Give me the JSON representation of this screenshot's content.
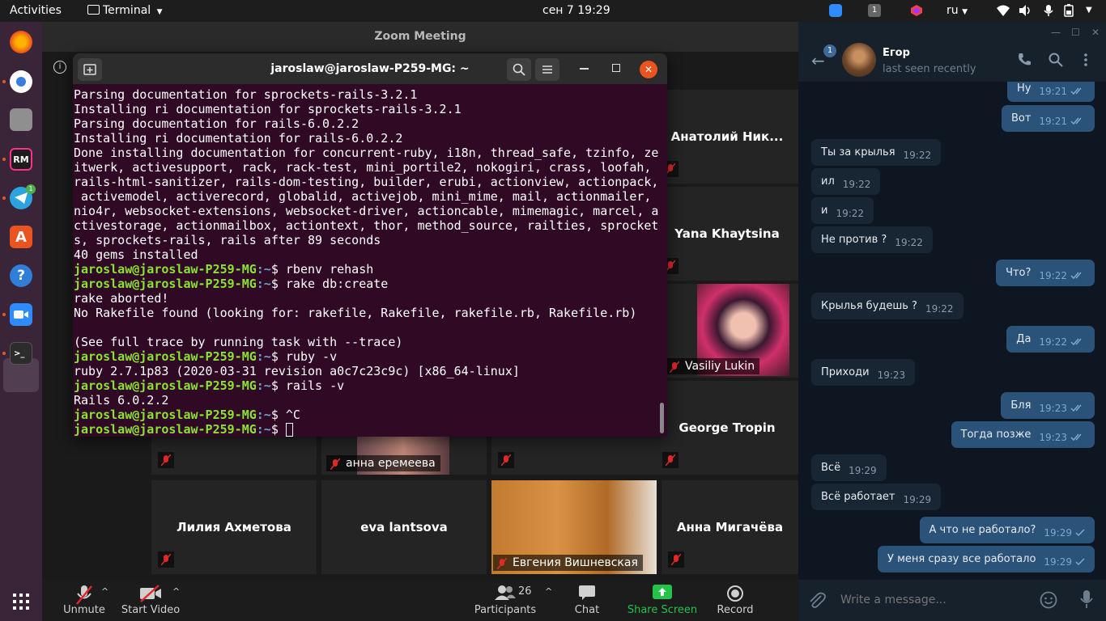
{
  "topbar": {
    "activities": "Activities",
    "app_menu": "Terminal",
    "clock": "сен 7  19:29",
    "language": "ru",
    "notif_count": "1"
  },
  "zoom": {
    "title": "Zoom Meeting",
    "participants_count": "26",
    "tiles": {
      "anatoly": "Анатолий Ник...",
      "yana": "Yana Khaytsina",
      "vasiliy": "Vasiliy Lukin",
      "george": "George Tropin",
      "anna_e": "анна еремеева",
      "liliya": "Лилия Ахметова",
      "eva": "eva lantsova",
      "evgeniya": "Евгения Вишневская",
      "anna_m": "Анна Мигачёва"
    },
    "toolbar": {
      "unmute": "Unmute",
      "start_video": "Start Video",
      "participants": "Participants",
      "chat": "Chat",
      "share_screen": "Share Screen",
      "record": "Record"
    }
  },
  "terminal": {
    "title": "jaroslaw@jaroslaw-P259-MG: ~",
    "prompt_user": "jaroslaw@jaroslaw-P259-MG",
    "prompt_path": ":~",
    "lines": [
      {
        "type": "out",
        "text": "Parsing documentation for sprockets-rails-3.2.1"
      },
      {
        "type": "out",
        "text": "Installing ri documentation for sprockets-rails-3.2.1"
      },
      {
        "type": "out",
        "text": "Parsing documentation for rails-6.0.2.2"
      },
      {
        "type": "out",
        "text": "Installing ri documentation for rails-6.0.2.2"
      },
      {
        "type": "out",
        "text": "Done installing documentation for concurrent-ruby, i18n, thread_safe, tzinfo, ze"
      },
      {
        "type": "out",
        "text": "itwerk, activesupport, rack, rack-test, mini_portile2, nokogiri, crass, loofah,"
      },
      {
        "type": "out",
        "text": "rails-html-sanitizer, rails-dom-testing, builder, erubi, actionview, actionpack,"
      },
      {
        "type": "out",
        "text": " activemodel, activerecord, globalid, activejob, mini_mime, mail, actionmailer,"
      },
      {
        "type": "out",
        "text": "nio4r, websocket-extensions, websocket-driver, actioncable, mimemagic, marcel, a"
      },
      {
        "type": "out",
        "text": "ctivestorage, actionmailbox, actiontext, thor, method_source, railties, sprocket"
      },
      {
        "type": "out",
        "text": "s, sprockets-rails, rails after 89 seconds"
      },
      {
        "type": "out",
        "text": "40 gems installed"
      },
      {
        "type": "cmd",
        "text": "$ rbenv rehash"
      },
      {
        "type": "cmd",
        "text": "$ rake db:create"
      },
      {
        "type": "out",
        "text": "rake aborted!"
      },
      {
        "type": "out",
        "text": "No Rakefile found (looking for: rakefile, Rakefile, rakefile.rb, Rakefile.rb)"
      },
      {
        "type": "out",
        "text": ""
      },
      {
        "type": "out",
        "text": "(See full trace by running task with --trace)"
      },
      {
        "type": "cmd",
        "text": "$ ruby -v"
      },
      {
        "type": "out",
        "text": "ruby 2.7.1p83 (2020-03-31 revision a0c7c23c9c) [x86_64-linux]"
      },
      {
        "type": "cmd",
        "text": "$ rails -v"
      },
      {
        "type": "out",
        "text": "Rails 6.0.2.2"
      },
      {
        "type": "cmd",
        "text": "$ ^C"
      },
      {
        "type": "cmd",
        "text": "$ ",
        "cursor": true
      }
    ]
  },
  "telegram": {
    "contact_name": "Егор",
    "status": "last seen recently",
    "unread_badge": "1",
    "input_placeholder": "Write a message...",
    "messages": [
      {
        "dir": "out",
        "text": "Ну",
        "time": "19:21",
        "read": true
      },
      {
        "dir": "out",
        "text": "Вот",
        "time": "19:21",
        "read": true
      },
      {
        "dir": "in",
        "text": "Ты за крылья",
        "time": "19:22"
      },
      {
        "dir": "in",
        "text": "ил",
        "time": "19:22"
      },
      {
        "dir": "in",
        "text": "и",
        "time": "19:22"
      },
      {
        "dir": "in",
        "text": "Не против ?",
        "time": "19:22"
      },
      {
        "dir": "out",
        "text": "Что?",
        "time": "19:22",
        "read": true
      },
      {
        "dir": "in",
        "text": "Крылья будешь ?",
        "time": "19:22"
      },
      {
        "dir": "out",
        "text": "Да",
        "time": "19:22",
        "read": true
      },
      {
        "dir": "in",
        "text": "Приходи",
        "time": "19:23"
      },
      {
        "dir": "out",
        "text": "Бля",
        "time": "19:23",
        "read": true
      },
      {
        "dir": "out",
        "text": "Тогда позже",
        "time": "19:23",
        "read": true
      },
      {
        "dir": "in",
        "text": "Всё",
        "time": "19:29"
      },
      {
        "dir": "in",
        "text": "Всё работает",
        "time": "19:29"
      },
      {
        "dir": "out",
        "text": "А что не работало?",
        "time": "19:29",
        "read": false
      },
      {
        "dir": "out",
        "text": "У меня сразу все работало",
        "time": "19:29",
        "read": false
      }
    ]
  },
  "colors": {
    "terminal_bg": "#300a24",
    "prompt_user": "#8ae234",
    "prompt_path": "#729fcf",
    "tg_out_bubble": "#2b5278",
    "tg_in_bubble": "#182533",
    "share_green": "#24c34a",
    "mute_red": "#e02828"
  }
}
